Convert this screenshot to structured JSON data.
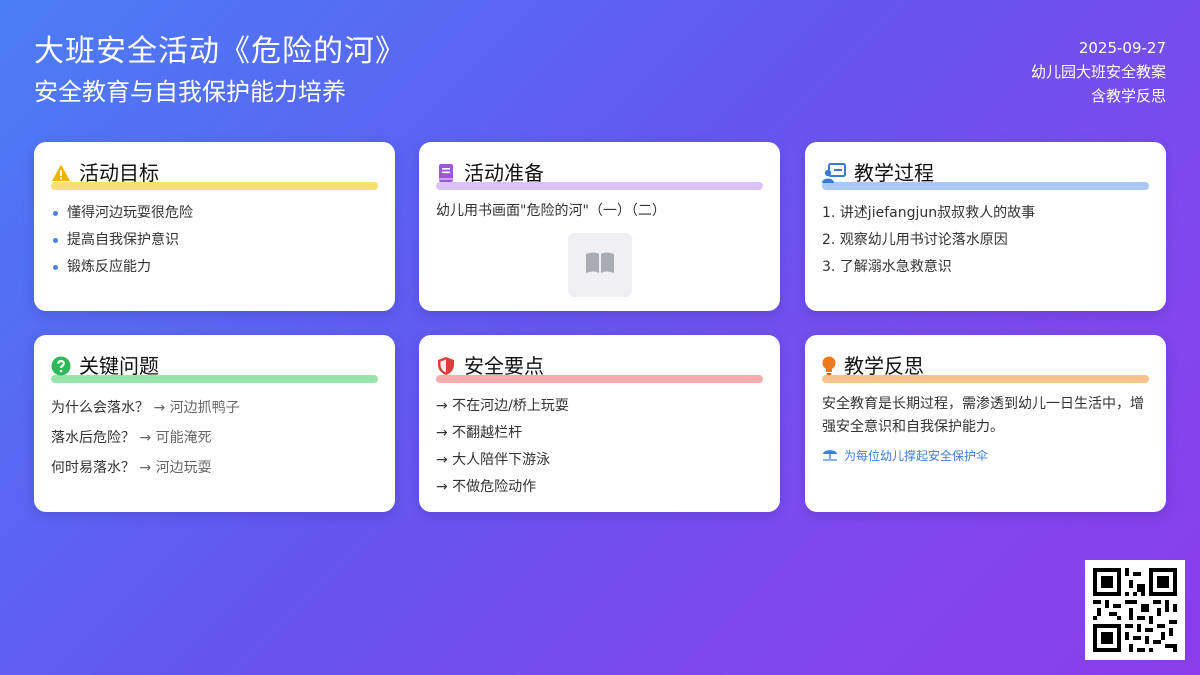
{
  "header": {
    "title": "大班安全活动《危险的河》",
    "subtitle": "安全教育与自我保护能力培养"
  },
  "meta": {
    "date": "2025-09-27",
    "type": "幼儿园大班安全教案",
    "note": "含教学反思"
  },
  "cards": {
    "goals": {
      "title": "活动目标",
      "icon": "warning-icon",
      "items": [
        "懂得河边玩耍很危险",
        "提高自我保护意识",
        "锻炼反应能力"
      ]
    },
    "prep": {
      "title": "活动准备",
      "icon": "book-icon",
      "text": "幼儿用书画面\"危险的河\"（一）（二）",
      "image_icon": "open-book-icon"
    },
    "process": {
      "title": "教学过程",
      "icon": "teacher-icon",
      "items": [
        "1. 讲述jiefangjun叔叔救人的故事",
        "2. 观察幼儿用书讨论落水原因",
        "3. 了解溺水急救意识"
      ]
    },
    "questions": {
      "title": "关键问题",
      "icon": "question-icon",
      "items": [
        {
          "q": "为什么会落水？",
          "a": "→ 河边抓鸭子"
        },
        {
          "q": "落水后危险？",
          "a": "→ 可能淹死"
        },
        {
          "q": "何时易落水？",
          "a": "→ 河边玩耍"
        }
      ]
    },
    "safety": {
      "title": "安全要点",
      "icon": "shield-icon",
      "items": [
        "→ 不在河边/桥上玩耍",
        "→ 不翻越栏杆",
        "→ 大人陪伴下游泳",
        "→ 不做危险动作"
      ]
    },
    "reflection": {
      "title": "教学反思",
      "icon": "lightbulb-icon",
      "text": "安全教育是长期过程，需渗透到幼儿一日生活中，增强安全意识和自我保护能力。",
      "tagline": "为每位幼儿撑起安全保护伞",
      "tagline_icon": "umbrella-icon"
    }
  },
  "qr": {
    "icon": "qr-code-icon"
  },
  "colors": {
    "gradient_start": "#4a7ef5",
    "gradient_end": "#8a3de8",
    "accent_blue": "#3d7ede"
  }
}
